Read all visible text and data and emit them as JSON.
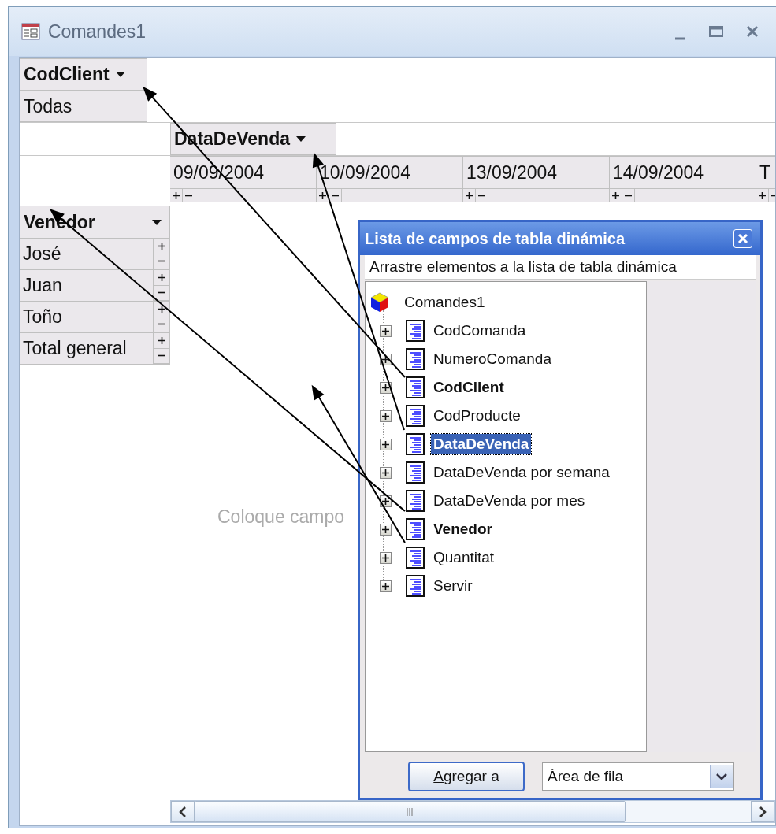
{
  "window": {
    "title": "Comandes1"
  },
  "pivot": {
    "filter_field": {
      "label": "CodClient",
      "value": "Todas"
    },
    "column_field": {
      "label": "DataDeVenda"
    },
    "column_items": [
      "09/09/2004",
      "10/09/2004",
      "13/09/2004",
      "14/09/2004",
      "T"
    ],
    "row_field": {
      "label": "Venedor"
    },
    "row_items": [
      "José",
      "Juan",
      "Toño",
      "Total general"
    ],
    "drop_hint": "Coloque campo"
  },
  "field_list": {
    "title": "Lista de campos de tabla dinámica",
    "instruction": "Arrastre elementos a la lista de tabla dinámica",
    "root": "Comandes1",
    "fields": [
      {
        "label": "CodComanda",
        "in_use": false,
        "selected": false
      },
      {
        "label": "NumeroComanda",
        "in_use": false,
        "selected": false
      },
      {
        "label": "CodClient",
        "in_use": true,
        "selected": false
      },
      {
        "label": "CodProducte",
        "in_use": false,
        "selected": false
      },
      {
        "label": "DataDeVenda",
        "in_use": true,
        "selected": true
      },
      {
        "label": "DataDeVenda por semana",
        "in_use": false,
        "selected": false
      },
      {
        "label": "DataDeVenda por mes",
        "in_use": false,
        "selected": false
      },
      {
        "label": "Venedor",
        "in_use": true,
        "selected": false
      },
      {
        "label": "Quantitat",
        "in_use": false,
        "selected": false
      },
      {
        "label": "Servir",
        "in_use": false,
        "selected": false
      }
    ],
    "add_button": "Agregar a",
    "area_select": "Área de fila"
  }
}
